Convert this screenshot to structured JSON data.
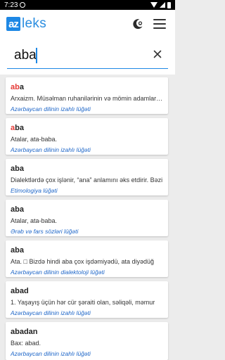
{
  "status_bar": {
    "time": "7:23"
  },
  "header": {
    "logo_mark": "az",
    "logo_text": "leks"
  },
  "search": {
    "value": "aba",
    "placeholder": ""
  },
  "results": [
    {
      "word_highlight": "ab",
      "word_rest": "a",
      "word_extra": "",
      "definition": "Arxaizm. Müsəlman ruhanilərinin və mömin adamların geydiyi üst paltarı",
      "source": "Azərbaycan dilinin izahlı lüğəti"
    },
    {
      "word_highlight": "a",
      "word_rest": "ba",
      "word_extra": "",
      "definition": "Atalar, ata-baba.",
      "source": "Azərbaycan dilinin izahlı lüğəti"
    },
    {
      "word_highlight": "",
      "word_rest": "aba",
      "word_extra": "",
      "definition": "Dialektlərdə çox işlənir, “ana” anlamını əks etdirir. Bəzi",
      "source": "Etimologiya lüğəti"
    },
    {
      "word_highlight": "",
      "word_rest": "aba",
      "word_extra": "",
      "definition": "Atalar, ata-baba.",
      "source": "Ərəb və fars sözləri lüğəti"
    },
    {
      "word_highlight": "",
      "word_rest": "aba",
      "word_extra": "",
      "definition": "Ata. □ Bizdə hindi aba çox işdəmiyədü, ata diyədüğ",
      "source": "Azərbaycan dilinin dialektoloji lüğəti"
    },
    {
      "word_highlight": "",
      "word_rest": "abad",
      "word_extra": "",
      "definition": "1. Yaşayış üçün hər cür şəraiti olan, səliqəli, məmur",
      "source": "Azərbaycan dilinin izahlı lüğəti"
    },
    {
      "word_highlight": "",
      "word_rest": "abadan",
      "word_extra": "",
      "definition": "Bax: abad.",
      "source": "Azərbaycan dilinin izahlı lüğəti"
    }
  ]
}
